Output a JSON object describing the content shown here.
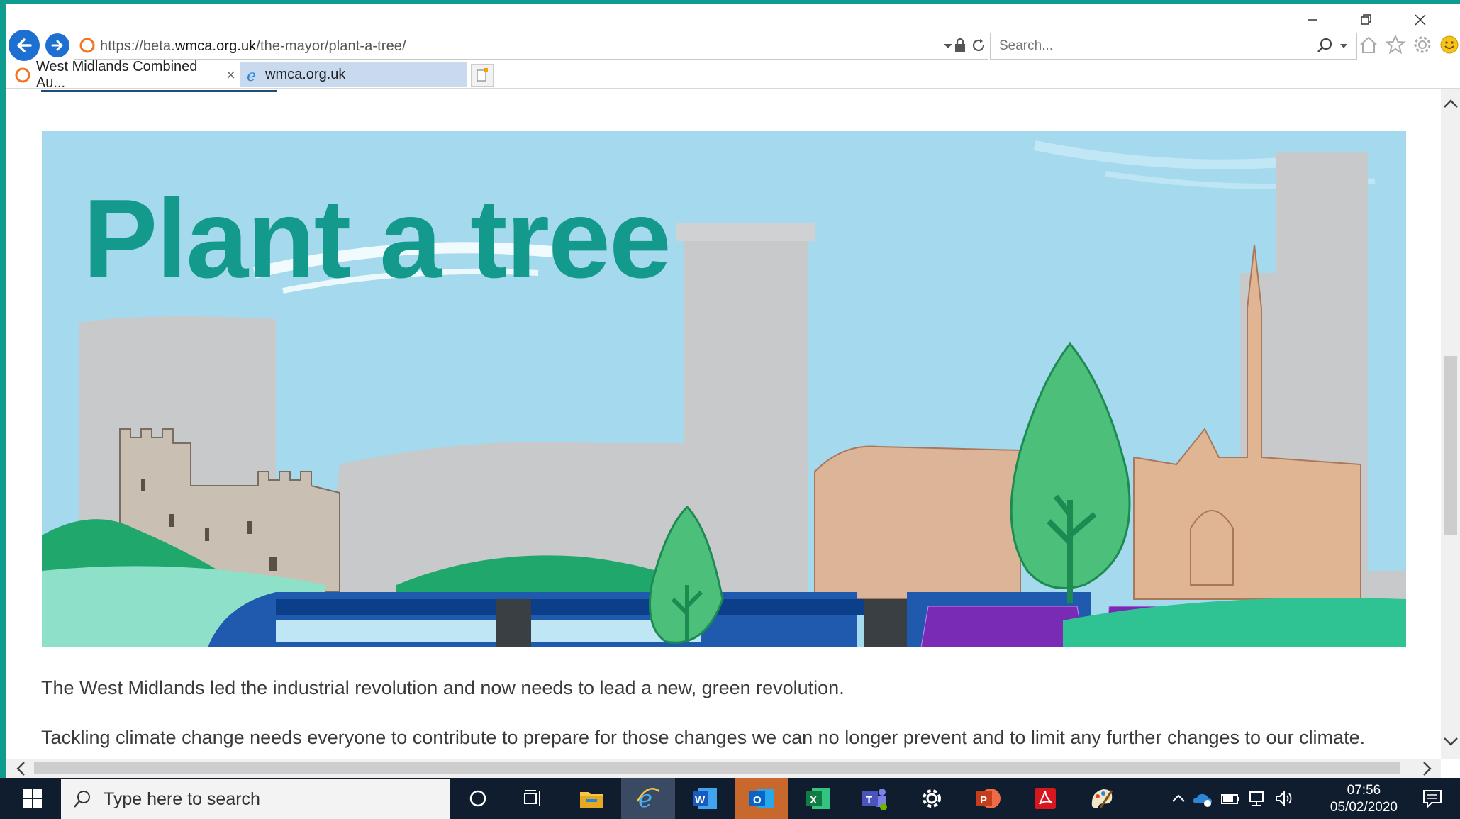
{
  "browser": {
    "url_prefix": "https://beta.",
    "url_domain": "wmca.org.uk",
    "url_path": "/the-mayor/plant-a-tree/",
    "search_placeholder": "Search...",
    "tabs": [
      {
        "label": "West Midlands Combined Au...",
        "close": "×",
        "active": true
      },
      {
        "label": "wmca.org.uk",
        "active": false
      }
    ]
  },
  "page": {
    "hero_title": "Plant a tree",
    "paragraphs": [
      "The West Midlands led the industrial revolution and now needs to lead a new, green revolution.",
      "Tackling climate change needs everyone to contribute to prepare for those changes we can no longer prevent and to limit any further changes to our climate."
    ]
  },
  "taskbar": {
    "search_placeholder": "Type here to search",
    "time": "07:56",
    "date": "05/02/2020",
    "apps": [
      "cortana-icon",
      "task-view-icon",
      "file-explorer-icon",
      "internet-explorer-icon",
      "word-icon",
      "outlook-icon",
      "excel-icon",
      "teams-icon",
      "settings-icon",
      "powerpoint-icon",
      "acrobat-icon",
      "paint-icon"
    ]
  },
  "colors": {
    "frame_teal": "#0f9b8e",
    "hero_sky": "#a4d9ee",
    "hero_title": "#139a8c",
    "taskbar": "#101d2f",
    "ie_blue": "#1e6fd2"
  }
}
